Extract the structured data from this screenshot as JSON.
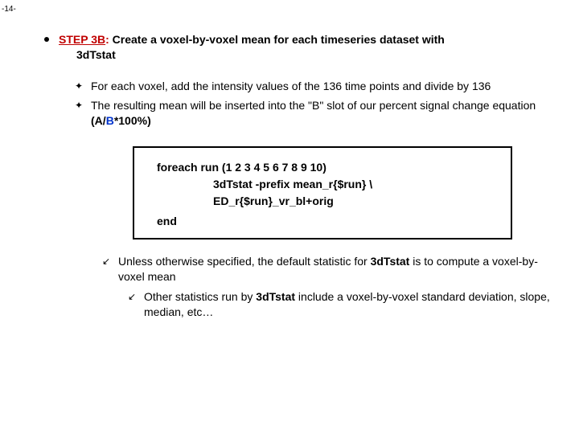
{
  "pageNumber": "-14-",
  "step": {
    "label": "STEP 3B",
    "colon": ": ",
    "desc": "Create a voxel-by-voxel mean for each timeseries dataset with",
    "program": "3dTstat"
  },
  "sub": [
    "For each voxel, add the intensity values of the 136 time points and divide by 136",
    "The resulting mean will be inserted into the \"B\" slot of our percent signal change equation "
  ],
  "eq": {
    "open": "(",
    "A": "A",
    "slash": "/",
    "B": "B",
    "rest": "*100%)"
  },
  "code": {
    "l1": "foreach run (1 2 3 4 5 6 7 8 9 10)",
    "l2": "3dTstat -prefix mean_r{$run}  \\",
    "l3": "ED_r{$run}_vr_bl+orig",
    "l4": "end"
  },
  "notes": {
    "n1a": "Unless otherwise specified, the default statistic for ",
    "n1b": "3dTstat",
    "n1c": " is to compute a voxel-by-voxel mean",
    "n2a": "Other statistics run by ",
    "n2b": "3dTstat",
    "n2c": " include a voxel-by-voxel standard deviation, slope, median, etc…"
  },
  "glyphs": {
    "sub": "✦",
    "arrow": "↙"
  }
}
